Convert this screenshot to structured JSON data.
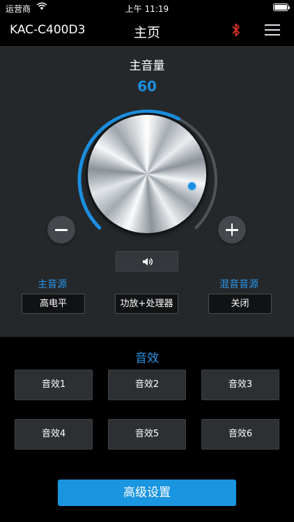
{
  "status_bar": {
    "carrier": "运营商",
    "time": "上午 11:19"
  },
  "header": {
    "device_name": "KAC-C400D3",
    "title": "主页"
  },
  "volume": {
    "title": "主音量",
    "value": 60,
    "max": 100
  },
  "sources": {
    "main_label": "主音源",
    "main_value": "高电平",
    "mode_value": "功放+处理器",
    "mix_label": "混音音源",
    "mix_value": "关闭"
  },
  "effects": {
    "title": "音效",
    "items": [
      "音效1",
      "音效2",
      "音效3",
      "音效4",
      "音效5",
      "音效6"
    ]
  },
  "advanced_button": "高级设置",
  "colors": {
    "accent": "#1a95e0",
    "bluetooth": "#e0302b",
    "panel": "#25282b"
  },
  "icons": [
    "wifi-icon",
    "battery-icon",
    "bluetooth-icon",
    "menu-icon",
    "minus-icon",
    "plus-icon",
    "speaker-icon"
  ]
}
